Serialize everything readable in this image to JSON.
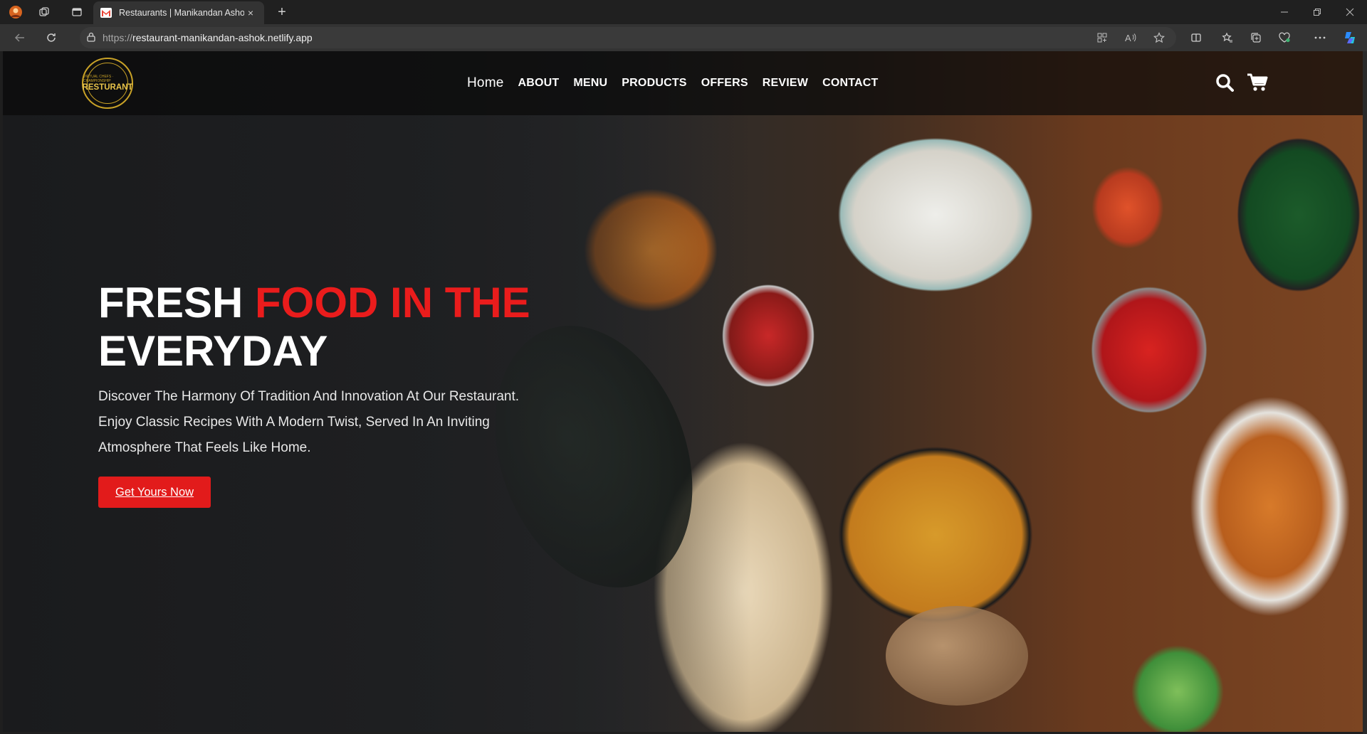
{
  "browser": {
    "tab": {
      "title": "Restaurants | Manikandan Ashok",
      "favicon": "gmail-m-icon"
    },
    "url": {
      "protocol": "https://",
      "host": "restaurant-manikandan-ashok.netlify.app"
    },
    "new_tab": "+",
    "close_tab": "×"
  },
  "site": {
    "logo": {
      "text": "RESTURANT",
      "subtext": "VIRTUAL CHEFS · CHAMPIONSHIP"
    },
    "nav": [
      {
        "label": "Home"
      },
      {
        "label": "ABOUT"
      },
      {
        "label": "MENU"
      },
      {
        "label": "PRODUCTS"
      },
      {
        "label": "OFFERS"
      },
      {
        "label": "REVIEW"
      },
      {
        "label": "CONTACT"
      }
    ],
    "icons": {
      "search": "search-icon",
      "cart": "cart-icon"
    }
  },
  "hero": {
    "title_white_1": "FRESH ",
    "title_red": "FOOD IN THE",
    "title_white_2": "EVERYDAY",
    "description": "Discover The Harmony Of Tradition And Innovation At Our Restaurant. Enjoy Classic Recipes With A Modern Twist, Served In An Inviting Atmosphere That Feels Like Home.",
    "cta_label": "Get Yours Now"
  },
  "colors": {
    "accent": "#e21b1b",
    "header_bg": "#0a0a0a",
    "logo_gold": "#c9a227"
  }
}
